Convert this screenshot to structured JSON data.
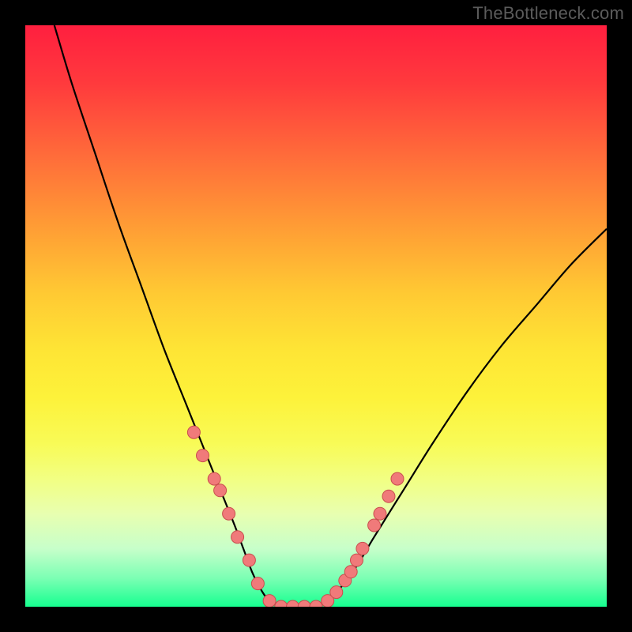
{
  "watermark": "TheBottleneck.com",
  "colors": {
    "background": "#000000",
    "curve": "#000000",
    "dot_fill": "#f07a7a",
    "dot_stroke": "#c94e4e"
  },
  "chart_data": {
    "type": "line",
    "title": "",
    "xlabel": "",
    "ylabel": "",
    "xlim": [
      0,
      100
    ],
    "ylim": [
      0,
      100
    ],
    "grid": false,
    "legend": false,
    "series": [
      {
        "name": "bottleneck_curve",
        "x": [
          5,
          8,
          12,
          16,
          20,
          24,
          28,
          32,
          34,
          36,
          37.5,
          39,
          40.5,
          42,
          44,
          46,
          48,
          50,
          52,
          54,
          57,
          60,
          65,
          70,
          76,
          82,
          88,
          94,
          100
        ],
        "y": [
          100,
          90,
          78,
          66,
          55,
          44,
          34,
          24,
          19,
          14,
          10,
          6,
          3,
          1,
          0,
          0,
          0,
          0,
          1,
          3,
          7,
          12,
          20,
          28,
          37,
          45,
          52,
          59,
          65
        ]
      }
    ],
    "dots": {
      "name": "highlighted_points",
      "x": [
        29,
        30.5,
        32.5,
        33.5,
        35,
        36.5,
        38.5,
        40,
        42,
        44,
        46,
        48,
        50,
        52,
        53.5,
        55,
        56,
        57,
        58,
        60,
        61,
        62.5,
        64
      ],
      "y": [
        30,
        26,
        22,
        20,
        16,
        12,
        8,
        4,
        1,
        0,
        0,
        0,
        0,
        1,
        2.5,
        4.5,
        6,
        8,
        10,
        14,
        16,
        19,
        22
      ]
    }
  }
}
